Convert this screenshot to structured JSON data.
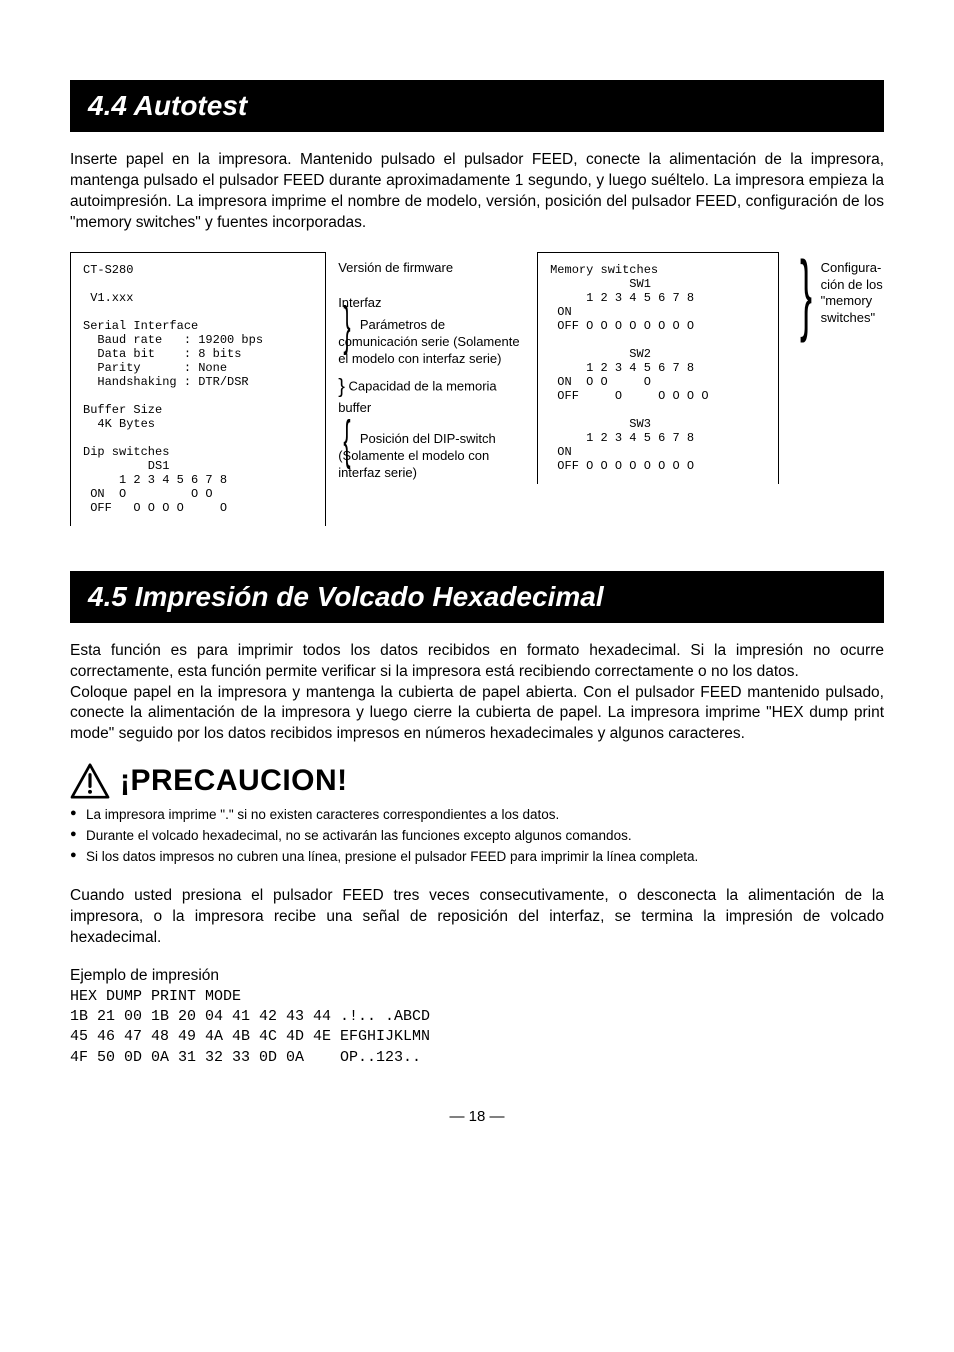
{
  "section44": {
    "title": "4.4  Autotest",
    "body": "Inserte papel en la impresora.  Mantenido pulsado el pulsador FEED, conecte la alimentación de la impresora, mantenga pulsado el pulsador FEED durante aproximadamente 1 segundo, y luego suéltelo.  La impresora empieza la autoimpresión. La impresora imprime el nombre de modelo, versión, posición del pulsador FEED, configuración de los \"memory switches\" y fuentes incorporadas."
  },
  "printout_left": "CT-S280\n\n V1.xxx\n\nSerial Interface\n  Baud rate   : 19200 bps\n  Data bit    : 8 bits\n  Parity      : None\n  Handshaking : DTR/DSR\n\nBuffer Size\n  4K Bytes\n\nDip switches\n         DS1\n     1 2 3 4 5 6 7 8\n ON  O         O O\n OFF   O O O O     O",
  "printout_right": "Memory switches\n           SW1\n     1 2 3 4 5 6 7 8\n ON\n OFF O O O O O O O O\n\n           SW2\n     1 2 3 4 5 6 7 8\n ON  O O     O\n OFF     O     O O O O\n\n           SW3\n     1 2 3 4 5 6 7 8\n ON\n OFF O O O O O O O O",
  "annot": {
    "firmware": "Versión de firmware",
    "interfaz": "Interfaz",
    "comms": "Parámetros de comunicación serie (Solamente el modelo con interfaz serie)",
    "buffer": "Capacidad de la memoria buffer",
    "dip": "Posición del DIP-switch (Solamente el modelo con interfaz serie)",
    "memsw": "Configura-ción de los \"memory switches\""
  },
  "section45": {
    "title": "4.5  Impresión de Volcado Hexadecimal",
    "body1": "Esta función es para imprimir todos los datos recibidos en formato hexadecimal.  Si la impresión no ocurre correctamente, esta función permite verificar si la impresora está recibiendo correctamente o no los datos.\nColoque papel en la impresora y mantenga la cubierta de papel abierta.  Con el pulsador FEED mantenido pulsado, conecte la alimentación de la impresora y luego cierre la cubierta de papel.  La impresora imprime \"HEX dump print mode\" seguido por los datos recibidos impresos en números hexadecimales y algunos caracteres.",
    "caution_title": "¡PRECAUCION!",
    "bullets": [
      "La impresora imprime \".\" si no existen caracteres correspondientes a los datos.",
      "Durante el volcado hexadecimal, no se activarán las funciones excepto algunos comandos.",
      "Si los datos impresos no cubren una línea, presione el pulsador FEED para imprimir la línea completa."
    ],
    "body2": "Cuando usted presiona el pulsador FEED tres veces consecutivamente, o desconecta la alimentación de la impresora, o la impresora recibe una señal de reposición del interfaz, se termina la impresión de volcado hexadecimal.",
    "example_label": "Ejemplo de impresión",
    "example": "HEX DUMP PRINT MODE\n1B 21 00 1B 20 04 41 42 43 44 .!.. .ABCD\n45 46 47 48 49 4A 4B 4C 4D 4E EFGHIJKLMN\n4F 50 0D 0A 31 32 33 0D 0A    OP..123.."
  },
  "page_number": "— 18 —"
}
